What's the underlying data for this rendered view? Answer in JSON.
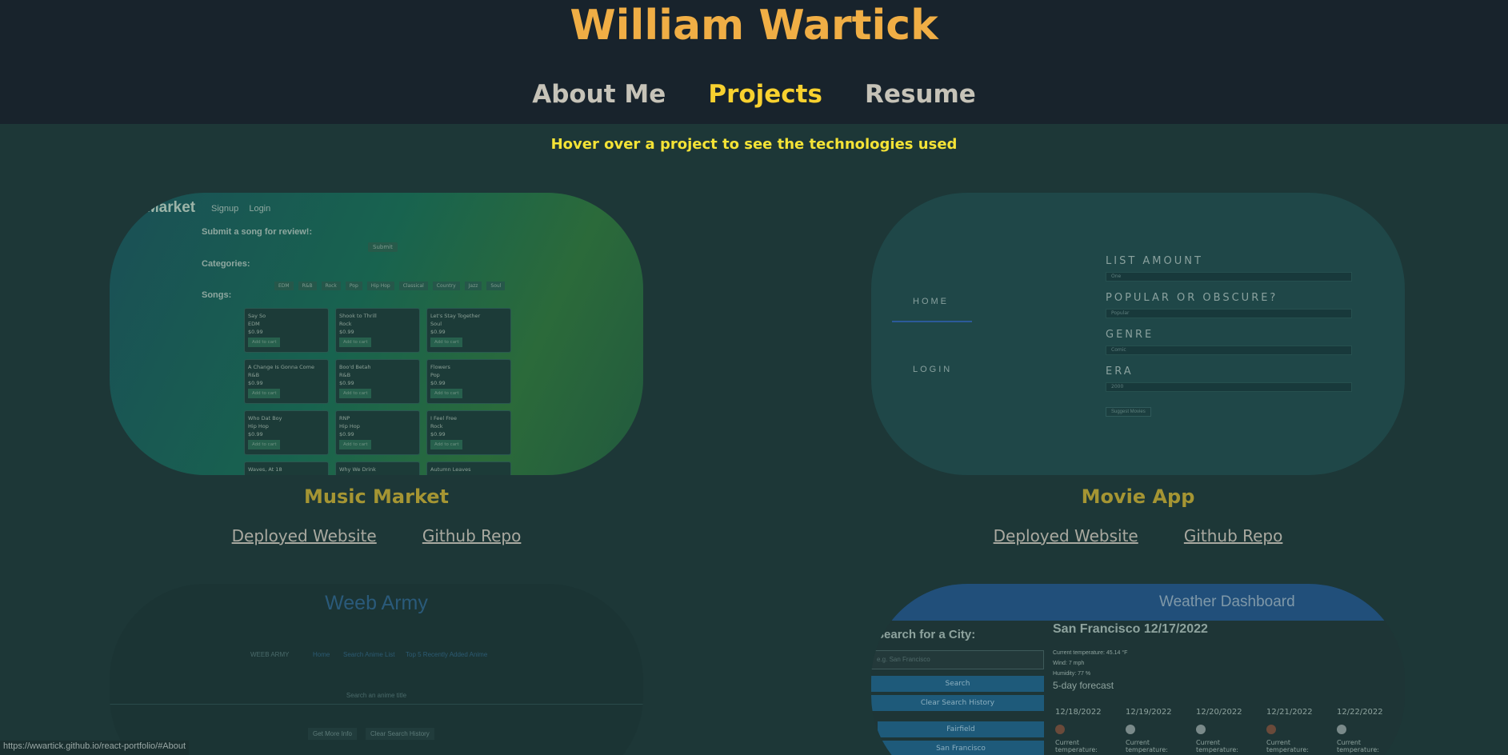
{
  "header": {
    "title": "William Wartick",
    "nav": [
      {
        "label": "About Me",
        "active": false
      },
      {
        "label": "Projects",
        "active": true
      },
      {
        "label": "Resume",
        "active": false
      }
    ]
  },
  "hint": "Hover over a project to see the technologies used",
  "projects": [
    {
      "title": "Music Market",
      "deployed": "Deployed Website",
      "repo": "Github Repo"
    },
    {
      "title": "Movie App",
      "deployed": "Deployed Website",
      "repo": "Github Repo"
    },
    {
      "title": "Weeb Army"
    },
    {
      "title": "Weather Dashboard"
    }
  ],
  "music_preview": {
    "logo": "c Market",
    "nav": [
      "Signup",
      "Login"
    ],
    "submit_label": "Submit a song for review!:",
    "submit_button": "Submit",
    "categories_label": "Categories:",
    "categories": [
      "EDM",
      "R&B",
      "Rock",
      "Pop",
      "Hip Hop",
      "Classical",
      "Country",
      "Jazz",
      "Soul"
    ],
    "songs_label": "Songs:",
    "songs": [
      {
        "name": "Say So",
        "genre": "EDM",
        "price": "$0.99"
      },
      {
        "name": "Shook to Thrill",
        "genre": "Rock",
        "price": "$0.99"
      },
      {
        "name": "Let's Stay Together",
        "genre": "Soul",
        "price": "$0.99"
      },
      {
        "name": "A Change Is Gonna Come",
        "genre": "R&B",
        "price": "$0.99"
      },
      {
        "name": "Boo'd Betah",
        "genre": "R&B",
        "price": "$0.99"
      },
      {
        "name": "Flowers",
        "genre": "Pop",
        "price": "$0.99"
      },
      {
        "name": "Who Dat Boy",
        "genre": "Hip Hop",
        "price": "$0.99"
      },
      {
        "name": "RNP",
        "genre": "Hip Hop",
        "price": "$0.99"
      },
      {
        "name": "I Feel Free",
        "genre": "Rock",
        "price": "$0.99"
      },
      {
        "name": "Waves, At 18",
        "genre": "",
        "price": ""
      },
      {
        "name": "Why We Drink",
        "genre": "",
        "price": ""
      },
      {
        "name": "Autumn Leaves",
        "genre": "",
        "price": ""
      }
    ],
    "add_to_cart": "Add to cart"
  },
  "movie_preview": {
    "home": "HOME",
    "login": "LOGIN",
    "fields": [
      {
        "label": "LIST AMOUNT",
        "value": "One"
      },
      {
        "label": "POPULAR OR OBSCURE?",
        "value": "Popular"
      },
      {
        "label": "GENRE",
        "value": "Comic"
      },
      {
        "label": "ERA",
        "value": "2000"
      }
    ],
    "submit": "Suggest Movies"
  },
  "weeb_preview": {
    "title": "Weeb Army",
    "nav": [
      "WEEB ARMY",
      "Home",
      "Search Anime List",
      "Top 5 Recently Added Anime"
    ],
    "search_placeholder": "Search an anime title",
    "buttons": [
      "Get More Info",
      "Clear Search History"
    ]
  },
  "weather_preview": {
    "title": "Weather Dashboard",
    "search_label": "Search for a City:",
    "search_placeholder": "e.g. San Francisco",
    "search_button": "Search",
    "clear_button": "Clear Search History",
    "history": [
      "Fairfield",
      "San Francisco"
    ],
    "city_heading": "San Francisco 12/17/2022",
    "current": [
      "Current temperature: 45.14 °F",
      "Wind: 7 mph",
      "Humidity: 77 %"
    ],
    "forecast_label": "5-day forecast",
    "forecast_dates": [
      "12/18/2022",
      "12/19/2022",
      "12/20/2022",
      "12/21/2022",
      "12/22/2022"
    ],
    "forecast_temp_label": "Current temperature:"
  },
  "status_url": "https://wwartick.github.io/react-portfolio/#About"
}
